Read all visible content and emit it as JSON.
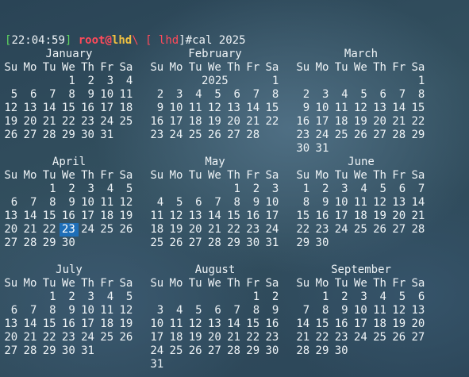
{
  "terminal": {
    "prompt_open": "[",
    "time": "22:04:59",
    "user": "root",
    "at": "@",
    "host": "lhd",
    "sep": "\\ [ ",
    "cwd": "lhd",
    "prompt_close": "]",
    "hash": "#",
    "command": "cal 2025",
    "year_header": "2025"
  },
  "calendar": {
    "weekdays": [
      "Su",
      "Mo",
      "Tu",
      "We",
      "Th",
      "Fr",
      "Sa"
    ],
    "today": {
      "month": 3,
      "day": 23
    },
    "months": [
      {
        "name": "January",
        "start": 3,
        "days": 31
      },
      {
        "name": "February",
        "start": 6,
        "days": 28
      },
      {
        "name": "March",
        "start": 6,
        "days": 31
      },
      {
        "name": "April",
        "start": 2,
        "days": 30
      },
      {
        "name": "May",
        "start": 4,
        "days": 31
      },
      {
        "name": "June",
        "start": 0,
        "days": 30
      },
      {
        "name": "July",
        "start": 2,
        "days": 31
      },
      {
        "name": "August",
        "start": 5,
        "days": 31
      },
      {
        "name": "September",
        "start": 1,
        "days": 30
      }
    ]
  }
}
